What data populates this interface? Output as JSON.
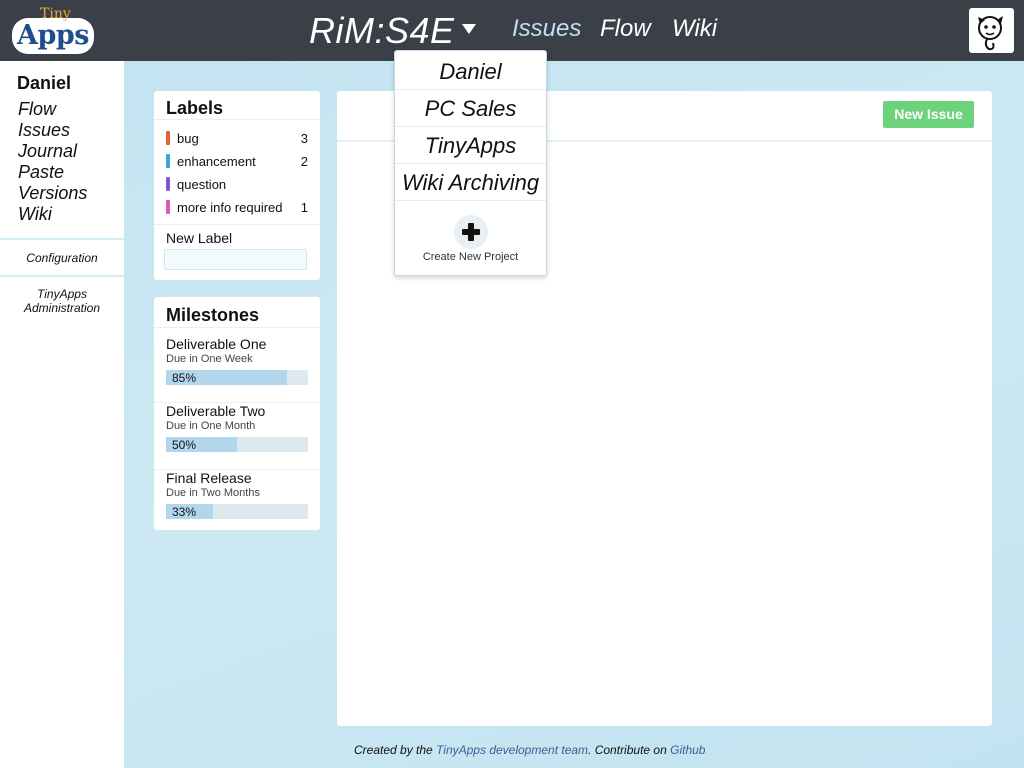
{
  "app": {
    "logo_small": "Tiny",
    "logo_big": "Apps"
  },
  "header": {
    "project_title": "RiM:S4E",
    "nav": [
      "Issues",
      "Flow",
      "Wiki"
    ],
    "active_nav": "Issues"
  },
  "sidebar": {
    "user": "Daniel",
    "items": [
      "Flow",
      "Issues",
      "Journal",
      "Paste",
      "Versions",
      "Wiki"
    ],
    "configuration": "Configuration",
    "admin_line1": "TinyApps",
    "admin_line2": "Administration"
  },
  "labels_panel": {
    "title": "Labels",
    "items": [
      {
        "name": "bug",
        "count": "3",
        "color": "#e0623a"
      },
      {
        "name": "enhancement",
        "count": "2",
        "color": "#3aa3e0"
      },
      {
        "name": "question",
        "count": "",
        "color": "#8a55d6"
      },
      {
        "name": "more info required",
        "count": "1",
        "color": "#e05aa8"
      }
    ],
    "new_label_text": "New Label",
    "new_label_value": ""
  },
  "milestones_panel": {
    "title": "Milestones",
    "items": [
      {
        "name": "Deliverable One",
        "due": "Due in One Week",
        "progress": 0.85,
        "progress_label": "85%"
      },
      {
        "name": "Deliverable Two",
        "due": "Due in One Month",
        "progress": 0.5,
        "progress_label": "50%"
      },
      {
        "name": "Final Release",
        "due": "Due in Two Months",
        "progress": 0.33,
        "progress_label": "33%"
      }
    ]
  },
  "issues": {
    "new_issue_label": "New Issue"
  },
  "project_dropdown": {
    "items": [
      "Daniel",
      "PC Sales",
      "TinyApps",
      "Wiki Archiving"
    ],
    "create_label": "Create New Project",
    "create_icon": "plus-icon"
  },
  "footer": {
    "prefix": "Created by the ",
    "team_link": "TinyApps development team",
    "middle": ". Contribute on ",
    "github_link": "Github"
  },
  "colors": {
    "topbar": "#3a3f48",
    "accent_green": "#6ed17c",
    "background_blue": "#c3e4f1",
    "progress_fill": "#b2d6ec"
  }
}
